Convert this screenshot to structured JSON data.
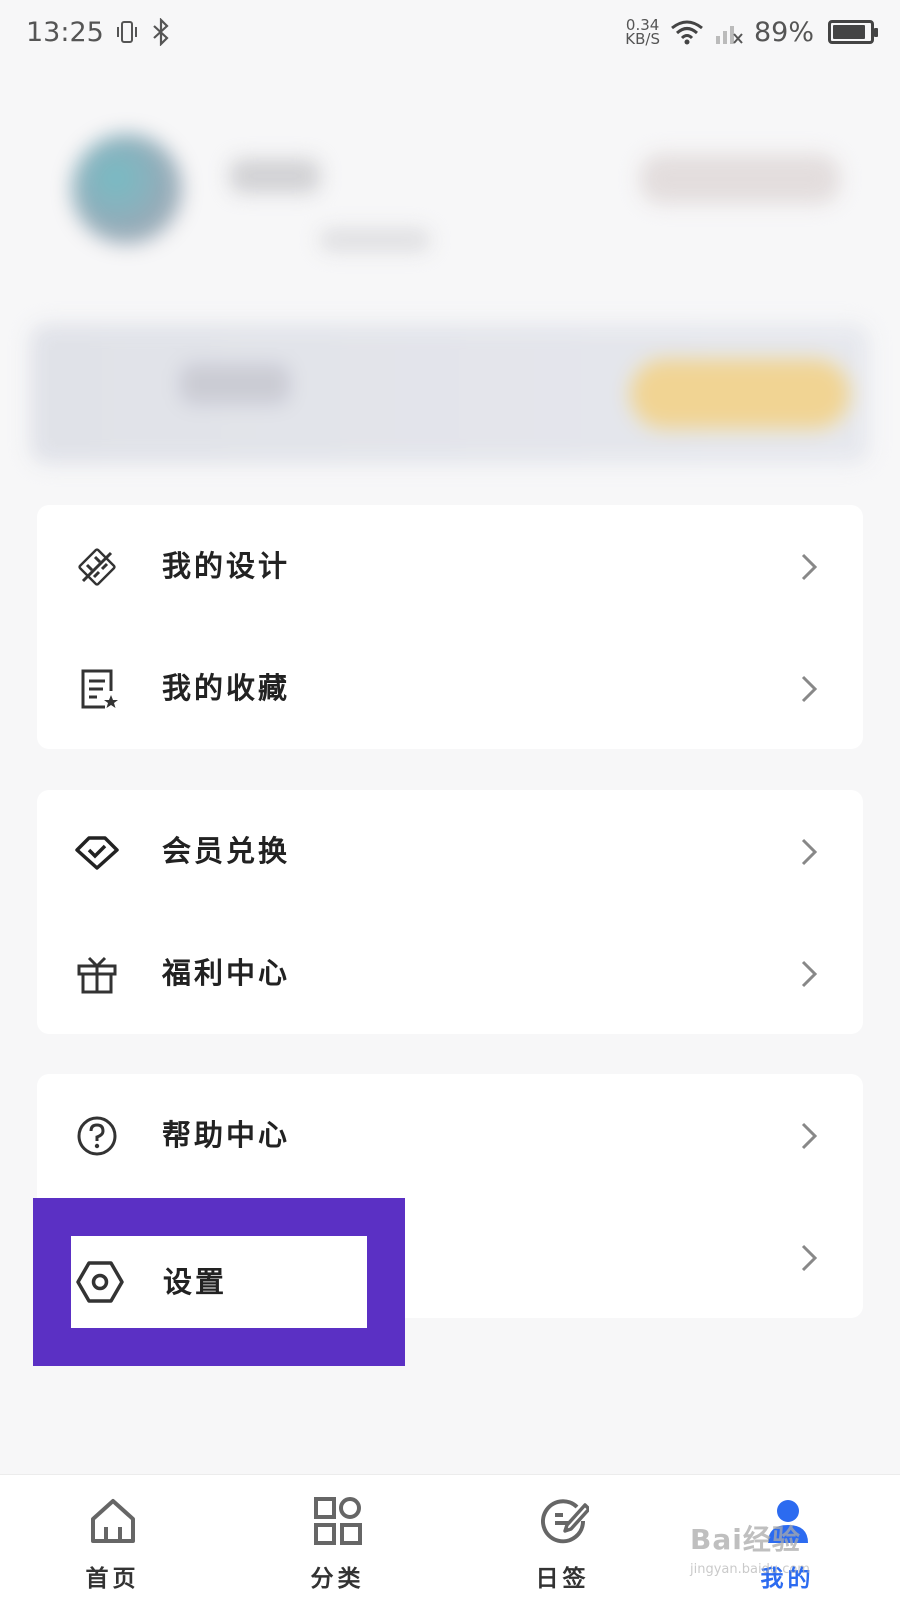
{
  "status_bar": {
    "time": "13:25",
    "net_speed_value": "0.34",
    "net_speed_unit": "KB/S",
    "battery_text": "89%",
    "battery_level": 0.89
  },
  "menu": {
    "group1": [
      {
        "label": "我的设计",
        "icon": "design-tools-icon"
      },
      {
        "label": "我的收藏",
        "icon": "favorites-list-icon"
      }
    ],
    "group2": [
      {
        "label": "会员兑换",
        "icon": "diamond-icon"
      },
      {
        "label": "福利中心",
        "icon": "gift-icon"
      }
    ],
    "group3": [
      {
        "label": "帮助中心",
        "icon": "help-icon"
      },
      {
        "label": "设置",
        "icon": "settings-icon"
      }
    ]
  },
  "bottom_nav": {
    "items": [
      {
        "label": "首页",
        "icon": "home-icon"
      },
      {
        "label": "分类",
        "icon": "category-grid-icon"
      },
      {
        "label": "日签",
        "icon": "daily-sign-icon"
      },
      {
        "label": "我的",
        "icon": "profile-icon"
      }
    ],
    "active_index": 3
  },
  "colors": {
    "accent": "#2c6bf0",
    "highlight": "#5b30c4",
    "vip_button": "#f1d38e"
  },
  "watermark": {
    "text": "Bai经验",
    "sub": "jingyan.baidu.com"
  }
}
